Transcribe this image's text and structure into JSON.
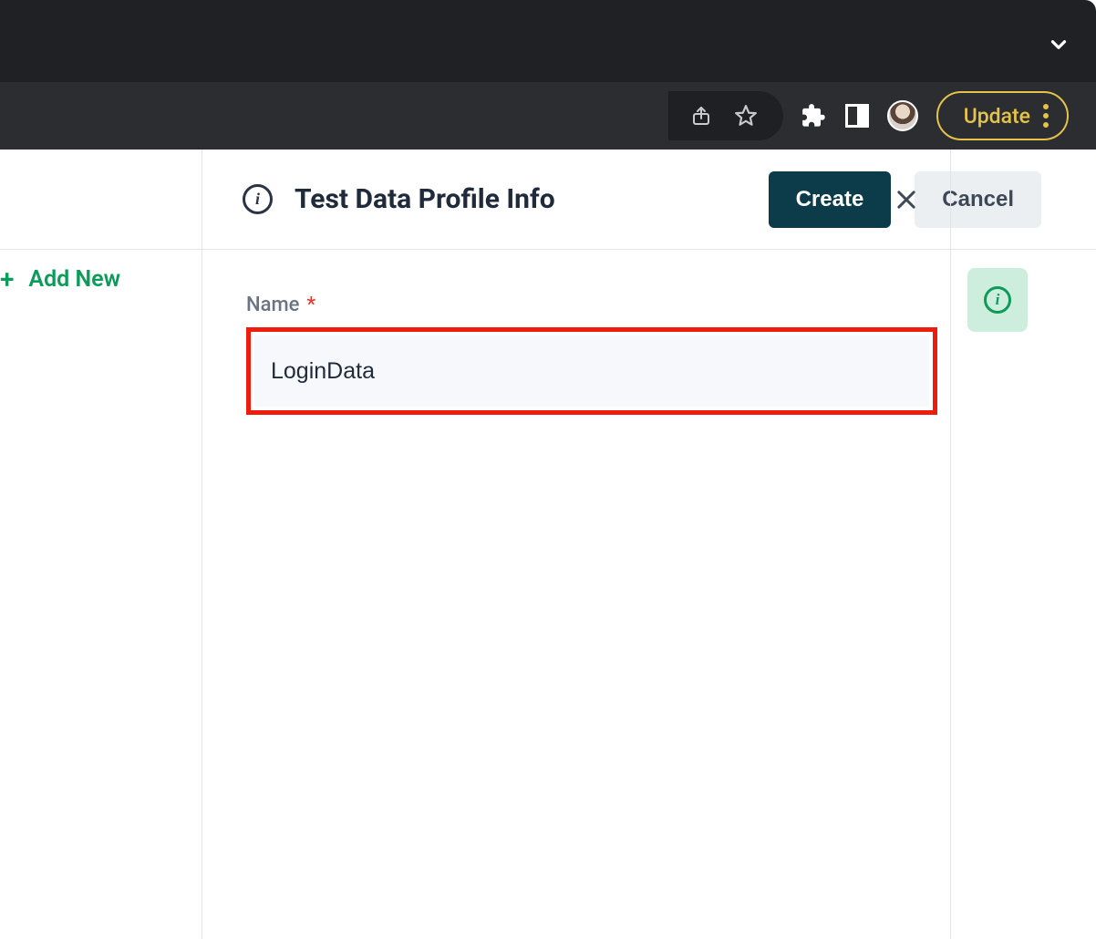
{
  "browser": {
    "update_label": "Update"
  },
  "actions": {
    "create_label": "Create",
    "cancel_label": "Cancel"
  },
  "sidebar": {
    "add_new_label": "Add New"
  },
  "panel": {
    "title": "Test Data Profile Info",
    "fields": {
      "name_label": "Name",
      "name_value": "LoginData"
    }
  }
}
